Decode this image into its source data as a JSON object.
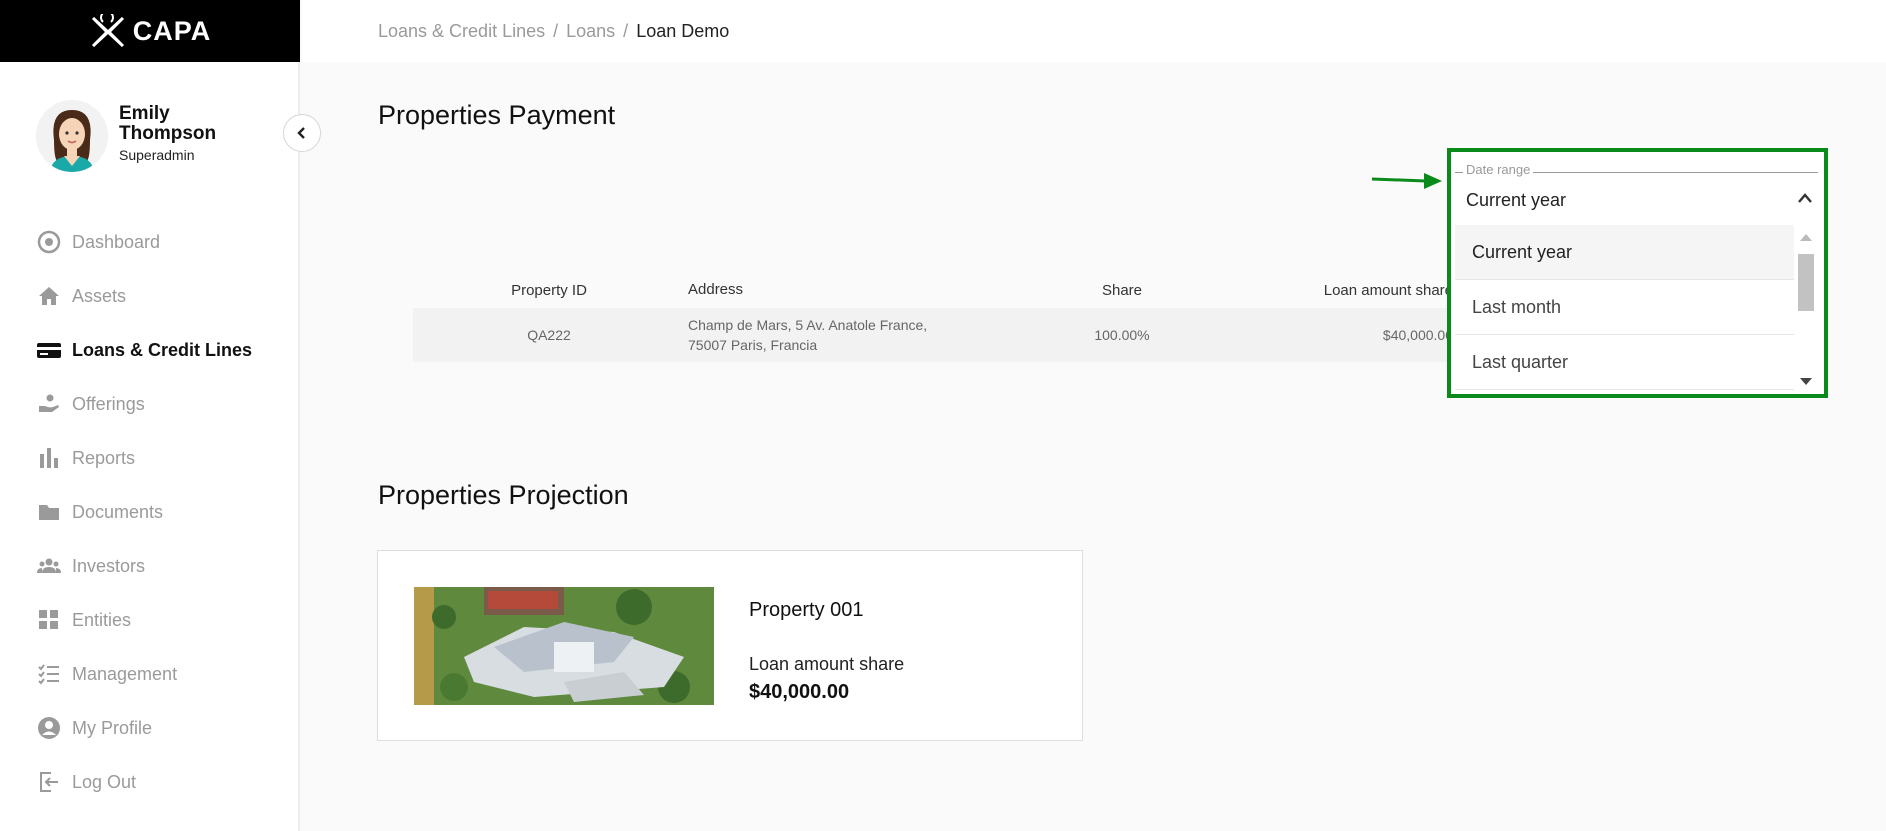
{
  "app": {
    "logo_text": "CAPA"
  },
  "breadcrumb": {
    "items": [
      "Loans & Credit Lines",
      "Loans"
    ],
    "separator": "/",
    "current": "Loan Demo"
  },
  "user": {
    "name": "Emily Thompson",
    "role": "Superadmin"
  },
  "sidebar": {
    "items": [
      {
        "label": "Dashboard",
        "icon": "dashboard-icon",
        "active": false
      },
      {
        "label": "Assets",
        "icon": "home-icon",
        "active": false
      },
      {
        "label": "Loans & Credit Lines",
        "icon": "credit-card-icon",
        "active": true
      },
      {
        "label": "Offerings",
        "icon": "hand-coin-icon",
        "active": false
      },
      {
        "label": "Reports",
        "icon": "bar-chart-icon",
        "active": false
      },
      {
        "label": "Documents",
        "icon": "folder-icon",
        "active": false
      },
      {
        "label": "Investors",
        "icon": "group-icon",
        "active": false
      },
      {
        "label": "Entities",
        "icon": "grid-icon",
        "active": false
      },
      {
        "label": "Management",
        "icon": "checklist-icon",
        "active": false
      },
      {
        "label": "My Profile",
        "icon": "user-circle-icon",
        "active": false
      },
      {
        "label": "Log Out",
        "icon": "logout-icon",
        "active": false
      }
    ]
  },
  "payment": {
    "title": "Properties Payment",
    "columns": [
      "Property ID",
      "Address",
      "Share",
      "Loan amount share"
    ],
    "rows": [
      {
        "property_id": "QA222",
        "address": "Champ de Mars, 5 Av. Anatole France, 75007 Paris, Francia",
        "share": "100.00%",
        "loan_amount_share": "$40,000.00"
      }
    ]
  },
  "date_range": {
    "label": "Date range",
    "value": "Current year",
    "options": [
      "Current year",
      "Last month",
      "Last quarter"
    ]
  },
  "projection": {
    "title": "Properties Projection",
    "card": {
      "title": "Property 001",
      "label": "Loan amount share",
      "value": "$40,000.00"
    }
  },
  "colors": {
    "highlight": "#0a8a1a",
    "logo_bg": "#000000"
  }
}
